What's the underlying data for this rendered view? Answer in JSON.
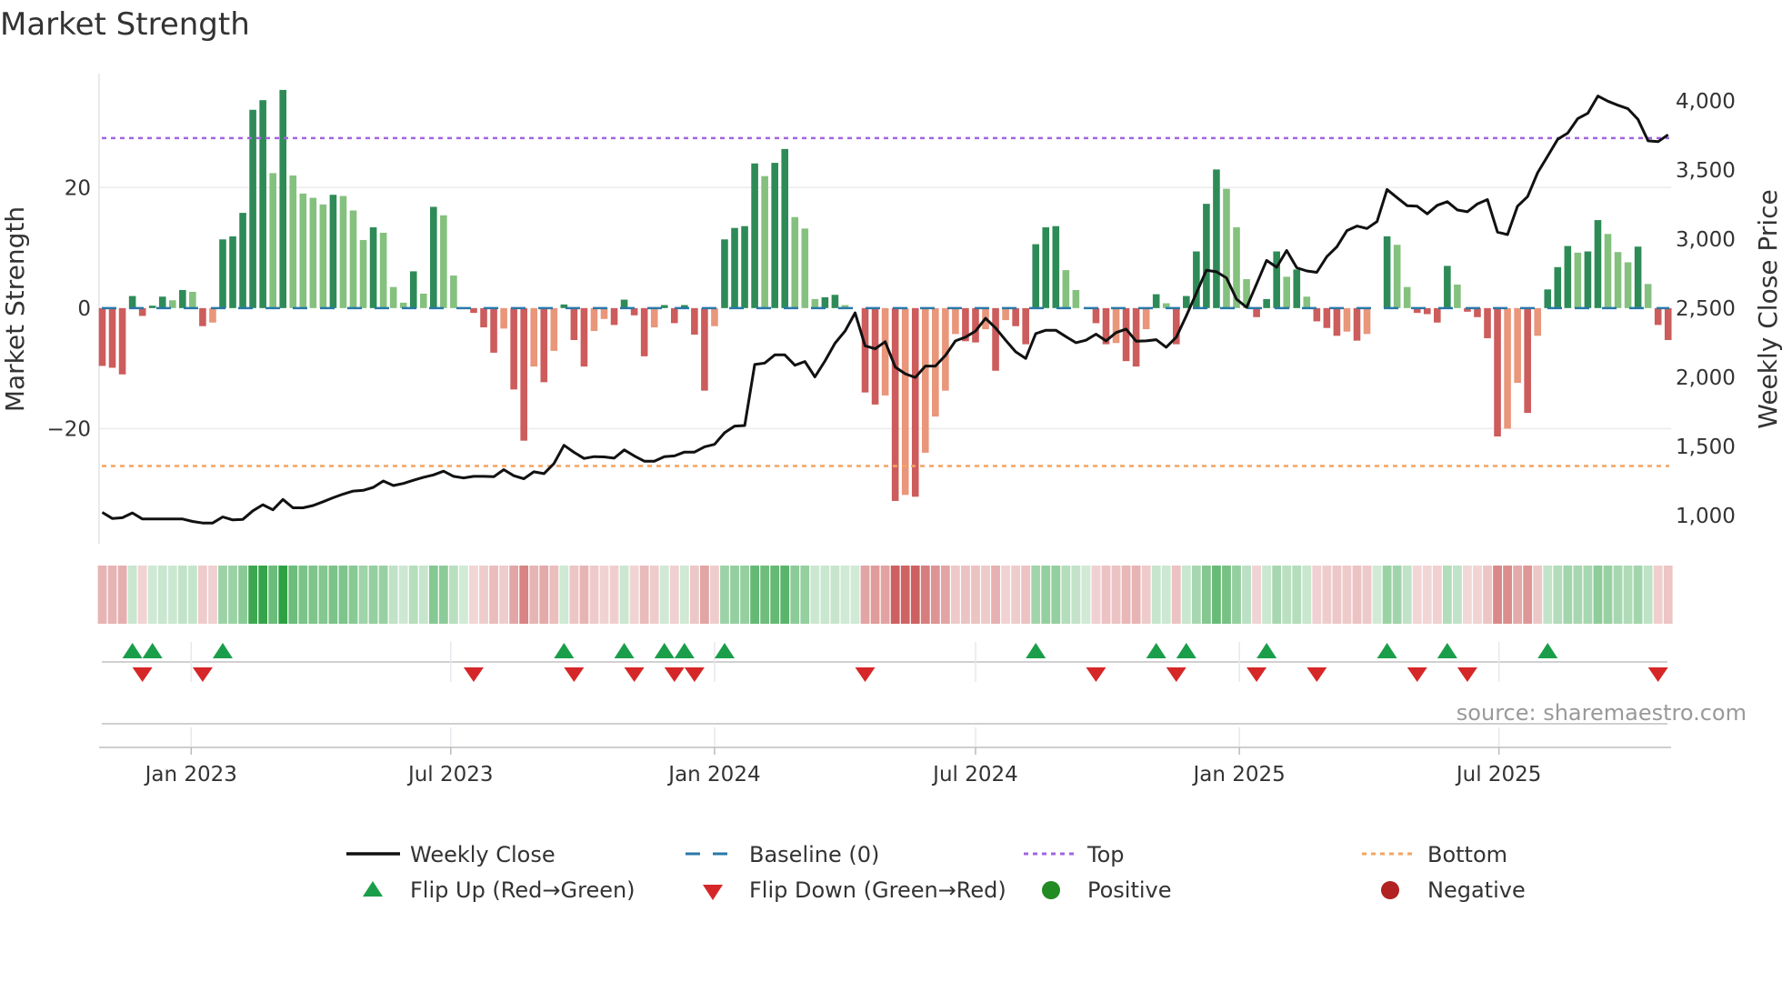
{
  "chart_data": {
    "type": "bar",
    "title": "Market Strength",
    "ylabel": "Market Strength",
    "y2label": "Weekly Close Price",
    "ylim": [
      -39.1,
      38.9
    ],
    "y2lim": [
      797,
      4197
    ],
    "yticks": [
      {
        "value": -20,
        "label": "−20"
      },
      {
        "value": 0,
        "label": "0"
      },
      {
        "value": 20,
        "label": "20"
      }
    ],
    "y2ticks": [
      {
        "value": 1000,
        "label": "1,000"
      },
      {
        "value": 1500,
        "label": "1,500"
      },
      {
        "value": 2000,
        "label": "2,000"
      },
      {
        "value": 2500,
        "label": "2,500"
      },
      {
        "value": 3000,
        "label": "3,000"
      },
      {
        "value": 3500,
        "label": "3,500"
      },
      {
        "value": 4000,
        "label": "4,000"
      }
    ],
    "xticks": [
      {
        "date": "2023-01-01",
        "label": "Jan 2023"
      },
      {
        "date": "2023-07-01",
        "label": "Jul 2023"
      },
      {
        "date": "2024-01-01",
        "label": "Jan 2024"
      },
      {
        "date": "2024-07-01",
        "label": "Jul 2024"
      },
      {
        "date": "2025-01-01",
        "label": "Jan 2025"
      },
      {
        "date": "2025-07-01",
        "label": "Jul 2025"
      }
    ],
    "start_date": "2022-10-31",
    "frequency": "weekly",
    "grid": true,
    "top_level": 28.2,
    "bottom_level": -26.2,
    "baseline": 0,
    "series": [
      {
        "name": "Market Strength",
        "type": "bar",
        "values": [
          -9.6,
          -9.9,
          -11,
          2,
          -1.3,
          0.4,
          1.9,
          1.3,
          3,
          2.7,
          -3,
          -2.4,
          11.4,
          11.9,
          15.8,
          32.9,
          34.5,
          22.4,
          36.2,
          22,
          19,
          18.3,
          17.2,
          18.8,
          18.6,
          16.2,
          11.3,
          13.4,
          12.5,
          3.5,
          0.9,
          6.1,
          2.4,
          16.8,
          15.4,
          5.4,
          0,
          -0.8,
          -3.2,
          -7.4,
          -3.4,
          -13.5,
          -22,
          -9.7,
          -12.3,
          -7.1,
          0.6,
          -5.3,
          -9.7,
          -3.8,
          -1.8,
          -2.8,
          1.4,
          -1.2,
          -8,
          -3.2,
          0.5,
          -2.5,
          0.5,
          -4.4,
          -13.7,
          -3,
          11.4,
          13.3,
          13.6,
          24,
          21.9,
          24.1,
          26.4,
          15.1,
          13.2,
          1.5,
          1.8,
          2.2,
          0.5,
          0,
          -14,
          -16,
          -14.5,
          -32,
          -31,
          -31.3,
          -24,
          -18,
          -13.7,
          -4.3,
          -5.5,
          -5.7,
          -3.5,
          -10.4,
          -2,
          -3,
          -6,
          10.6,
          13.4,
          13.6,
          6.3,
          3,
          0,
          -2.5,
          -6,
          -5.8,
          -8.8,
          -9.7,
          -3.5,
          2.3,
          0.8,
          -6,
          2,
          9.4,
          17.3,
          23,
          19.8,
          13.4,
          4.8,
          -1.5,
          1.5,
          9.4,
          5.2,
          6.4,
          1.9,
          -2.2,
          -3.3,
          -4.6,
          -3.9,
          -5.4,
          -4.3,
          0,
          11.9,
          10.5,
          3.5,
          -0.8,
          -1,
          -2.4,
          7,
          3.9,
          -0.6,
          -1.5,
          -5,
          -21.3,
          -20,
          -12.4,
          -17.4,
          -4.6,
          3.1,
          6.8,
          10.3,
          9.2,
          9.4,
          14.6,
          12.3,
          9.3,
          7.6,
          10.2,
          4,
          -2.8,
          -5.3
        ]
      },
      {
        "name": "Weekly Close",
        "type": "line",
        "axis": "right",
        "values": [
          1024,
          980,
          985,
          1020,
          976,
          976,
          976,
          976,
          976,
          958,
          947,
          947,
          991,
          969,
          973,
          1035,
          1079,
          1042,
          1117,
          1057,
          1057,
          1073,
          1101,
          1130,
          1156,
          1178,
          1183,
          1205,
          1251,
          1218,
          1233,
          1256,
          1278,
          1295,
          1322,
          1284,
          1273,
          1284,
          1284,
          1282,
          1333,
          1289,
          1267,
          1317,
          1304,
          1377,
          1509,
          1458,
          1414,
          1427,
          1425,
          1416,
          1476,
          1432,
          1394,
          1394,
          1427,
          1432,
          1460,
          1460,
          1498,
          1516,
          1600,
          1648,
          1652,
          2093,
          2104,
          2163,
          2163,
          2088,
          2115,
          2004,
          2119,
          2247,
          2335,
          2467,
          2229,
          2207,
          2258,
          2075,
          2026,
          2000,
          2082,
          2082,
          2159,
          2264,
          2291,
          2335,
          2427,
          2357,
          2269,
          2185,
          2137,
          2317,
          2341,
          2341,
          2295,
          2251,
          2269,
          2313,
          2264,
          2324,
          2350,
          2262,
          2264,
          2273,
          2218,
          2291,
          2445,
          2610,
          2775,
          2764,
          2720,
          2566,
          2507,
          2676,
          2846,
          2797,
          2918,
          2793,
          2770,
          2760,
          2874,
          2945,
          3062,
          3095,
          3077,
          3128,
          3359,
          3300,
          3242,
          3238,
          3183,
          3245,
          3271,
          3211,
          3198,
          3255,
          3286,
          3051,
          3033,
          3238,
          3308,
          3480,
          3601,
          3722,
          3767,
          3872,
          3910,
          4035,
          3998,
          3969,
          3943,
          3866,
          3711,
          3705,
          3755
        ]
      }
    ],
    "flip_up_weeks": [
      4,
      6,
      13,
      47,
      53,
      57,
      59,
      63,
      94,
      106,
      109,
      117,
      129,
      135,
      145
    ],
    "flip_down_weeks": [
      5,
      11,
      38,
      48,
      54,
      58,
      60,
      77,
      100,
      108,
      116,
      122,
      132,
      137,
      156
    ],
    "legend": {
      "placement": "bottom",
      "items": [
        {
          "label": "Weekly Close"
        },
        {
          "label": "Baseline (0)"
        },
        {
          "label": "Top"
        },
        {
          "label": "Bottom"
        },
        {
          "label": "Flip Up (Red→Green)"
        },
        {
          "label": "Flip Down (Green→Red)"
        },
        {
          "label": "Positive"
        },
        {
          "label": "Negative"
        }
      ]
    },
    "annotation": "source: sharemaestro.com"
  },
  "colors": {
    "pos_strong": "#2e8b57",
    "pos_weak": "#85c17e",
    "neg_strong": "#cd5c5c",
    "neg_weak": "#e9967a",
    "line": "#111111",
    "baseline": "#2a78a8",
    "top": "#a066e0",
    "bottom": "#f4a460",
    "flip_up": "#1a9e4a",
    "flip_down": "#d62728",
    "positive": "#228b22",
    "negative": "#b22222"
  }
}
